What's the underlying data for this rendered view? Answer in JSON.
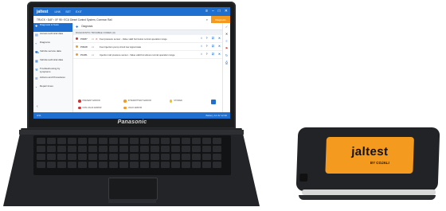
{
  "colors": {
    "accent": "#1f6fd0",
    "brand_orange": "#f39a1f",
    "danger": "#d33333"
  },
  "app": {
    "logo": "jaltest",
    "nav": [
      "LINK",
      "SET",
      "EXIT"
    ],
    "window_controls": [
      "≡",
      "–",
      "□",
      "✕"
    ]
  },
  "breadcrumb": {
    "text": "TRUCK › DAF › XF 95 › ECU Diesel Control System, Common Rail",
    "orange_button": "Diagnosis"
  },
  "sidebar": {
    "items": [
      {
        "label": "Diagnosis & Tests",
        "icon": "stethoscope-icon",
        "active": true
      },
      {
        "label": "Access technical data",
        "icon": "book-icon"
      },
      {
        "label": "Diagrams",
        "icon": "diagram-icon"
      },
      {
        "label": "Vehicle service data",
        "icon": "car-icon"
      },
      {
        "label": "Vehicle technical data",
        "icon": "document-icon"
      },
      {
        "label": "Troubleshooting by symptoms",
        "icon": "wrench-icon"
      },
      {
        "label": "Actions and Procedures",
        "icon": "list-icon"
      },
      {
        "label": "Repair times",
        "icon": "clock-icon"
      }
    ],
    "back_icon": "‹"
  },
  "main": {
    "title": "Diagnosis",
    "section": "DIAGNOSTIC TROUBLE CODES (3)",
    "dtcs": [
      {
        "code": "P0087",
        "badge": "x1",
        "warning": true,
        "description": "Fuel pressure sensor - Value valid but below normal operation range"
      },
      {
        "code": "P0628",
        "badge": "x1",
        "warning": false,
        "description": "Fuel injection pump circuit low signal state"
      },
      {
        "code": "P1081",
        "badge": "x1",
        "warning": false,
        "description": "Injection rail pressure sensor - Value valid but above normal operation range"
      }
    ],
    "actions": [
      "i",
      "?",
      "☑",
      "✕"
    ],
    "legend": [
      {
        "label": "PRESENT ERROR",
        "color": "#d33333"
      },
      {
        "label": "INTERMITTENT ERROR",
        "color": "#f39a1f"
      },
      {
        "label": "STORED",
        "color": "#f3c11f"
      },
      {
        "label": "NON-VALID ERROR",
        "color": "#d33333"
      },
      {
        "label": "VALID ERROR",
        "color": "#f39a1f"
      }
    ]
  },
  "rightbar": [
    "✓",
    "✕",
    "≡",
    "⚑",
    "↻",
    "⎙"
  ],
  "status": {
    "left": "3/11",
    "right": "Battery 12.4V   12:30"
  },
  "laptop": {
    "brand": "Panasonic"
  },
  "device": {
    "logo": "jaltest",
    "sub": "BY COJALI"
  }
}
